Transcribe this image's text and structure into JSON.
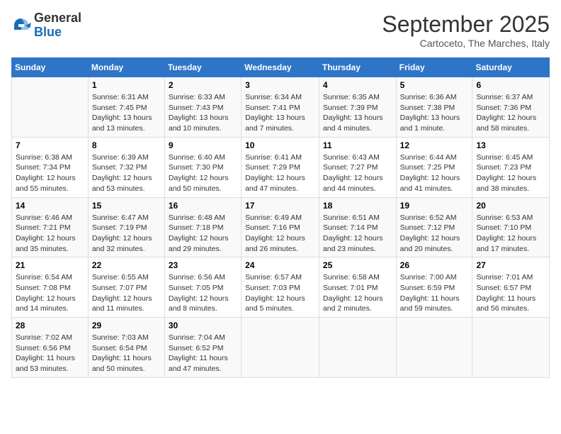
{
  "header": {
    "logo": {
      "line1": "General",
      "line2": "Blue"
    },
    "title": "September 2025",
    "location": "Cartoceto, The Marches, Italy"
  },
  "days_of_week": [
    "Sunday",
    "Monday",
    "Tuesday",
    "Wednesday",
    "Thursday",
    "Friday",
    "Saturday"
  ],
  "weeks": [
    [
      {
        "day": "",
        "info": ""
      },
      {
        "day": "1",
        "info": "Sunrise: 6:31 AM\nSunset: 7:45 PM\nDaylight: 13 hours\nand 13 minutes."
      },
      {
        "day": "2",
        "info": "Sunrise: 6:33 AM\nSunset: 7:43 PM\nDaylight: 13 hours\nand 10 minutes."
      },
      {
        "day": "3",
        "info": "Sunrise: 6:34 AM\nSunset: 7:41 PM\nDaylight: 13 hours\nand 7 minutes."
      },
      {
        "day": "4",
        "info": "Sunrise: 6:35 AM\nSunset: 7:39 PM\nDaylight: 13 hours\nand 4 minutes."
      },
      {
        "day": "5",
        "info": "Sunrise: 6:36 AM\nSunset: 7:38 PM\nDaylight: 13 hours\nand 1 minute."
      },
      {
        "day": "6",
        "info": "Sunrise: 6:37 AM\nSunset: 7:36 PM\nDaylight: 12 hours\nand 58 minutes."
      }
    ],
    [
      {
        "day": "7",
        "info": "Sunrise: 6:38 AM\nSunset: 7:34 PM\nDaylight: 12 hours\nand 55 minutes."
      },
      {
        "day": "8",
        "info": "Sunrise: 6:39 AM\nSunset: 7:32 PM\nDaylight: 12 hours\nand 53 minutes."
      },
      {
        "day": "9",
        "info": "Sunrise: 6:40 AM\nSunset: 7:30 PM\nDaylight: 12 hours\nand 50 minutes."
      },
      {
        "day": "10",
        "info": "Sunrise: 6:41 AM\nSunset: 7:29 PM\nDaylight: 12 hours\nand 47 minutes."
      },
      {
        "day": "11",
        "info": "Sunrise: 6:43 AM\nSunset: 7:27 PM\nDaylight: 12 hours\nand 44 minutes."
      },
      {
        "day": "12",
        "info": "Sunrise: 6:44 AM\nSunset: 7:25 PM\nDaylight: 12 hours\nand 41 minutes."
      },
      {
        "day": "13",
        "info": "Sunrise: 6:45 AM\nSunset: 7:23 PM\nDaylight: 12 hours\nand 38 minutes."
      }
    ],
    [
      {
        "day": "14",
        "info": "Sunrise: 6:46 AM\nSunset: 7:21 PM\nDaylight: 12 hours\nand 35 minutes."
      },
      {
        "day": "15",
        "info": "Sunrise: 6:47 AM\nSunset: 7:19 PM\nDaylight: 12 hours\nand 32 minutes."
      },
      {
        "day": "16",
        "info": "Sunrise: 6:48 AM\nSunset: 7:18 PM\nDaylight: 12 hours\nand 29 minutes."
      },
      {
        "day": "17",
        "info": "Sunrise: 6:49 AM\nSunset: 7:16 PM\nDaylight: 12 hours\nand 26 minutes."
      },
      {
        "day": "18",
        "info": "Sunrise: 6:51 AM\nSunset: 7:14 PM\nDaylight: 12 hours\nand 23 minutes."
      },
      {
        "day": "19",
        "info": "Sunrise: 6:52 AM\nSunset: 7:12 PM\nDaylight: 12 hours\nand 20 minutes."
      },
      {
        "day": "20",
        "info": "Sunrise: 6:53 AM\nSunset: 7:10 PM\nDaylight: 12 hours\nand 17 minutes."
      }
    ],
    [
      {
        "day": "21",
        "info": "Sunrise: 6:54 AM\nSunset: 7:08 PM\nDaylight: 12 hours\nand 14 minutes."
      },
      {
        "day": "22",
        "info": "Sunrise: 6:55 AM\nSunset: 7:07 PM\nDaylight: 12 hours\nand 11 minutes."
      },
      {
        "day": "23",
        "info": "Sunrise: 6:56 AM\nSunset: 7:05 PM\nDaylight: 12 hours\nand 8 minutes."
      },
      {
        "day": "24",
        "info": "Sunrise: 6:57 AM\nSunset: 7:03 PM\nDaylight: 12 hours\nand 5 minutes."
      },
      {
        "day": "25",
        "info": "Sunrise: 6:58 AM\nSunset: 7:01 PM\nDaylight: 12 hours\nand 2 minutes."
      },
      {
        "day": "26",
        "info": "Sunrise: 7:00 AM\nSunset: 6:59 PM\nDaylight: 11 hours\nand 59 minutes."
      },
      {
        "day": "27",
        "info": "Sunrise: 7:01 AM\nSunset: 6:57 PM\nDaylight: 11 hours\nand 56 minutes."
      }
    ],
    [
      {
        "day": "28",
        "info": "Sunrise: 7:02 AM\nSunset: 6:56 PM\nDaylight: 11 hours\nand 53 minutes."
      },
      {
        "day": "29",
        "info": "Sunrise: 7:03 AM\nSunset: 6:54 PM\nDaylight: 11 hours\nand 50 minutes."
      },
      {
        "day": "30",
        "info": "Sunrise: 7:04 AM\nSunset: 6:52 PM\nDaylight: 11 hours\nand 47 minutes."
      },
      {
        "day": "",
        "info": ""
      },
      {
        "day": "",
        "info": ""
      },
      {
        "day": "",
        "info": ""
      },
      {
        "day": "",
        "info": ""
      }
    ]
  ]
}
